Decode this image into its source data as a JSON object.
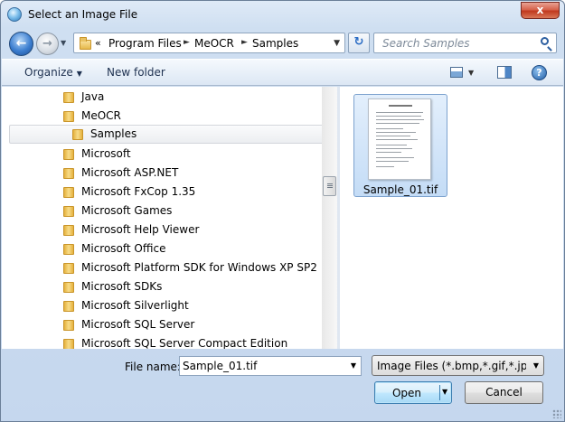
{
  "window": {
    "title": "Select an Image File",
    "close_glyph": "x"
  },
  "nav": {
    "back_glyph": "←",
    "forward_glyph": "→",
    "history_glyph": "▼"
  },
  "address": {
    "overflow_glyph": "«",
    "breadcrumbs": [
      "Program Files",
      "MeOCR",
      "Samples"
    ],
    "separator_glyph": "►",
    "dropdown_glyph": "▼",
    "refresh_glyph": "↻"
  },
  "search": {
    "placeholder": "Search Samples"
  },
  "toolbar": {
    "organize_label": "Organize",
    "dropdown_glyph": "▼",
    "new_folder_label": "New folder",
    "help_glyph": "?"
  },
  "tree": {
    "items": [
      {
        "label": "Java"
      },
      {
        "label": "MeOCR"
      },
      {
        "label": "Samples"
      },
      {
        "label": "Microsoft"
      },
      {
        "label": "Microsoft ASP.NET"
      },
      {
        "label": "Microsoft FxCop 1.35"
      },
      {
        "label": "Microsoft Games"
      },
      {
        "label": "Microsoft Help Viewer"
      },
      {
        "label": "Microsoft Office"
      },
      {
        "label": "Microsoft Platform SDK for Windows XP SP2"
      },
      {
        "label": "Microsoft SDKs"
      },
      {
        "label": "Microsoft Silverlight"
      },
      {
        "label": "Microsoft SQL Server"
      },
      {
        "label": "Microsoft SQL Server Compact Edition"
      }
    ],
    "selected": "Samples"
  },
  "files": [
    {
      "name": "Sample_01.tif"
    }
  ],
  "bottom": {
    "file_name_label": "File name:",
    "file_name_value": "Sample_01.tif",
    "file_type_value": "Image Files (*.bmp,*.gif,*.jpg,*.",
    "dropdown_glyph": "▼",
    "open_label": "Open",
    "cancel_label": "Cancel"
  },
  "colors": {
    "accent": "#3c7fb1",
    "selection": "#c4dcf6",
    "close": "#c0381e"
  }
}
